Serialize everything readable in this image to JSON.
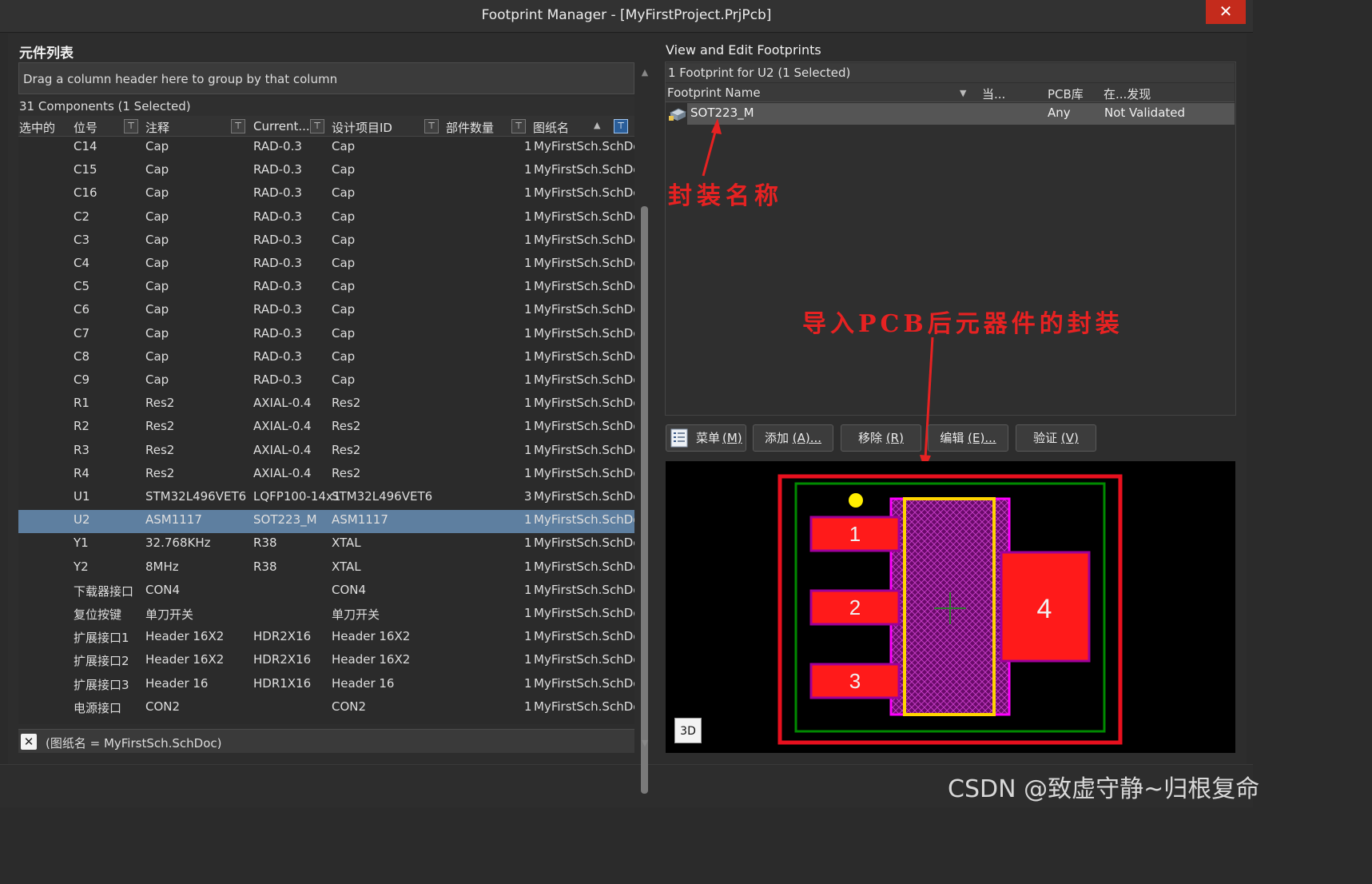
{
  "window": {
    "title": "Footprint Manager - [MyFirstProject.PrjPcb]",
    "close_glyph": "✕"
  },
  "left_panel": {
    "title": "元件列表",
    "group_hint": "Drag a column header here to group by that column",
    "count_text": "31 Components (1 Selected)",
    "columns": {
      "selected": "选中的",
      "designator": "位号",
      "comment": "注释",
      "current": "Current...",
      "design_id": "设计项目ID",
      "count": "部件数量",
      "sheet": "图纸名"
    },
    "rows": [
      {
        "designator": "C14",
        "comment": "Cap",
        "current": "RAD-0.3",
        "design_id": "Cap",
        "count": "1",
        "sheet": "MyFirstSch.SchDoc"
      },
      {
        "designator": "C15",
        "comment": "Cap",
        "current": "RAD-0.3",
        "design_id": "Cap",
        "count": "1",
        "sheet": "MyFirstSch.SchDoc"
      },
      {
        "designator": "C16",
        "comment": "Cap",
        "current": "RAD-0.3",
        "design_id": "Cap",
        "count": "1",
        "sheet": "MyFirstSch.SchDoc"
      },
      {
        "designator": "C2",
        "comment": "Cap",
        "current": "RAD-0.3",
        "design_id": "Cap",
        "count": "1",
        "sheet": "MyFirstSch.SchDoc"
      },
      {
        "designator": "C3",
        "comment": "Cap",
        "current": "RAD-0.3",
        "design_id": "Cap",
        "count": "1",
        "sheet": "MyFirstSch.SchDoc"
      },
      {
        "designator": "C4",
        "comment": "Cap",
        "current": "RAD-0.3",
        "design_id": "Cap",
        "count": "1",
        "sheet": "MyFirstSch.SchDoc"
      },
      {
        "designator": "C5",
        "comment": "Cap",
        "current": "RAD-0.3",
        "design_id": "Cap",
        "count": "1",
        "sheet": "MyFirstSch.SchDoc"
      },
      {
        "designator": "C6",
        "comment": "Cap",
        "current": "RAD-0.3",
        "design_id": "Cap",
        "count": "1",
        "sheet": "MyFirstSch.SchDoc"
      },
      {
        "designator": "C7",
        "comment": "Cap",
        "current": "RAD-0.3",
        "design_id": "Cap",
        "count": "1",
        "sheet": "MyFirstSch.SchDoc"
      },
      {
        "designator": "C8",
        "comment": "Cap",
        "current": "RAD-0.3",
        "design_id": "Cap",
        "count": "1",
        "sheet": "MyFirstSch.SchDoc"
      },
      {
        "designator": "C9",
        "comment": "Cap",
        "current": "RAD-0.3",
        "design_id": "Cap",
        "count": "1",
        "sheet": "MyFirstSch.SchDoc"
      },
      {
        "designator": "R1",
        "comment": "Res2",
        "current": "AXIAL-0.4",
        "design_id": "Res2",
        "count": "1",
        "sheet": "MyFirstSch.SchDoc"
      },
      {
        "designator": "R2",
        "comment": "Res2",
        "current": "AXIAL-0.4",
        "design_id": "Res2",
        "count": "1",
        "sheet": "MyFirstSch.SchDoc"
      },
      {
        "designator": "R3",
        "comment": "Res2",
        "current": "AXIAL-0.4",
        "design_id": "Res2",
        "count": "1",
        "sheet": "MyFirstSch.SchDoc"
      },
      {
        "designator": "R4",
        "comment": "Res2",
        "current": "AXIAL-0.4",
        "design_id": "Res2",
        "count": "1",
        "sheet": "MyFirstSch.SchDoc"
      },
      {
        "designator": "U1",
        "comment": "STM32L496VET6",
        "current": "LQFP100-14x1",
        "design_id": "STM32L496VET6",
        "count": "3",
        "sheet": "MyFirstSch.SchDoc"
      },
      {
        "designator": "U2",
        "comment": "ASM1117",
        "current": "SOT223_M",
        "design_id": "ASM1117",
        "count": "1",
        "sheet": "MyFirstSch.SchDoc",
        "selected": true
      },
      {
        "designator": "Y1",
        "comment": "32.768KHz",
        "current": "R38",
        "design_id": "XTAL",
        "count": "1",
        "sheet": "MyFirstSch.SchDoc"
      },
      {
        "designator": "Y2",
        "comment": "8MHz",
        "current": "R38",
        "design_id": "XTAL",
        "count": "1",
        "sheet": "MyFirstSch.SchDoc"
      },
      {
        "designator": "下载器接口",
        "comment": "CON4",
        "current": "",
        "design_id": "CON4",
        "count": "1",
        "sheet": "MyFirstSch.SchDoc"
      },
      {
        "designator": "复位按键",
        "comment": "单刀开关",
        "current": "",
        "design_id": "单刀开关",
        "count": "1",
        "sheet": "MyFirstSch.SchDoc"
      },
      {
        "designator": "扩展接口1",
        "comment": "Header 16X2",
        "current": "HDR2X16",
        "design_id": "Header 16X2",
        "count": "1",
        "sheet": "MyFirstSch.SchDoc"
      },
      {
        "designator": "扩展接口2",
        "comment": "Header 16X2",
        "current": "HDR2X16",
        "design_id": "Header 16X2",
        "count": "1",
        "sheet": "MyFirstSch.SchDoc"
      },
      {
        "designator": "扩展接口3",
        "comment": "Header 16",
        "current": "HDR1X16",
        "design_id": "Header 16",
        "count": "1",
        "sheet": "MyFirstSch.SchDoc"
      },
      {
        "designator": "电源接口",
        "comment": "CON2",
        "current": "",
        "design_id": "CON2",
        "count": "1",
        "sheet": "MyFirstSch.SchDoc"
      }
    ],
    "filter_text": "(图纸名 = MyFirstSch.SchDoc)",
    "filter_clear_glyph": "✕"
  },
  "right_panel": {
    "title": "View and Edit Footprints",
    "caption": "1 Footprint for U2 (1 Selected)",
    "columns": {
      "name": "Footprint Name",
      "current": "当...",
      "pcb_lib": "PCB库",
      "found_in": "在...发现"
    },
    "footprint": {
      "name": "SOT223_M",
      "pcb_lib": "Any",
      "found_in": "Not Validated"
    },
    "annotation_name": "封装名称",
    "annotation_preview": "导入PCB后元器件的封装",
    "buttons": {
      "menu": "菜单",
      "menu_key": "(M)",
      "add": "添加",
      "add_key": "(A)...",
      "remove": "移除",
      "remove_key": "(R)",
      "edit": "编辑",
      "edit_key": "(E)...",
      "validate": "验证",
      "validate_key": "(V)"
    },
    "preview": {
      "pad_labels": [
        "1",
        "2",
        "3",
        "4"
      ],
      "button_3d": "3D"
    }
  },
  "watermark": "CSDN @致虚守静~归根复命",
  "colors": {
    "selected_row": "#5e7fa0",
    "annotation": "#e62222",
    "pad": "#ff1a1a",
    "courtyard": "#ff00ff",
    "silkscreen": "#ffd400",
    "outline": "#008a00"
  }
}
